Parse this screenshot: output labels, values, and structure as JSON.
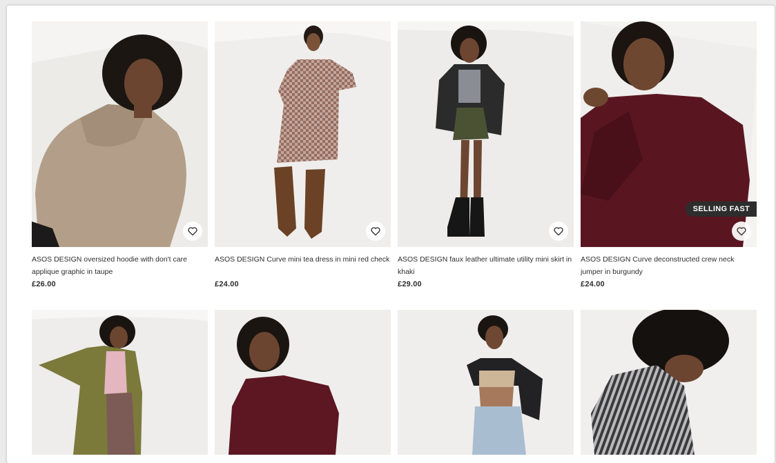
{
  "products": [
    {
      "title": "ASOS DESIGN oversized hoodie with don't care applique graphic in taupe",
      "price": "£26.00",
      "badge": ""
    },
    {
      "title": "ASOS DESIGN Curve mini tea dress in mini red check",
      "price": "£24.00",
      "badge": ""
    },
    {
      "title": "ASOS DESIGN faux leather ultimate utility mini skirt in khaki",
      "price": "£29.00",
      "badge": ""
    },
    {
      "title": "ASOS DESIGN Curve deconstructed crew neck jumper in burgundy",
      "price": "£24.00",
      "badge": "SELLING FAST"
    }
  ],
  "icons": {
    "wishlist": "heart-outline-icon"
  },
  "colors": {
    "text": "#2d2d2d",
    "badge_bg": "#2d2d2d",
    "badge_text": "#ffffff",
    "photo_bg": "#f2f1ef"
  }
}
